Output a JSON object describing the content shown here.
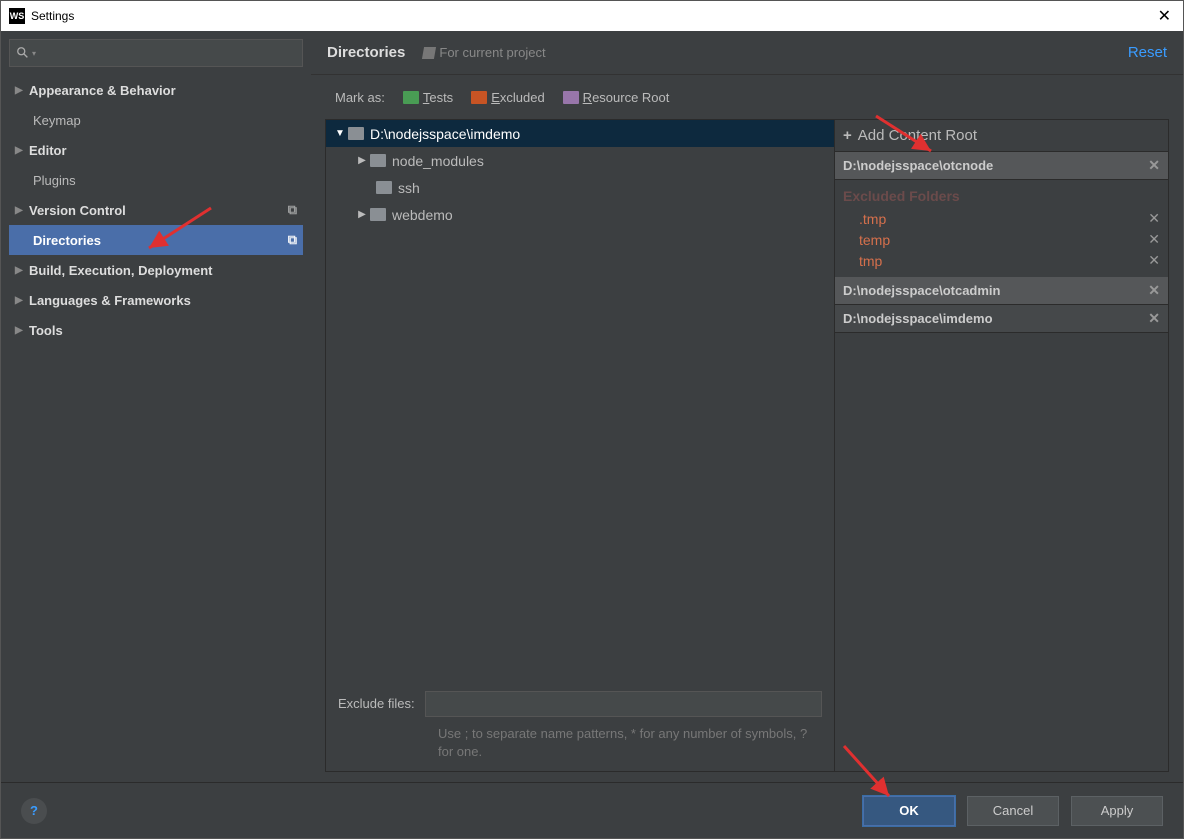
{
  "titlebar": {
    "logo": "WS",
    "title": "Settings"
  },
  "search": {
    "placeholder": ""
  },
  "sidebar": {
    "items": [
      {
        "label": "Appearance & Behavior",
        "bold": true,
        "arrow": true
      },
      {
        "label": "Keymap",
        "bold": false,
        "child": true
      },
      {
        "label": "Editor",
        "bold": true,
        "arrow": true
      },
      {
        "label": "Plugins",
        "bold": false,
        "child": true
      },
      {
        "label": "Version Control",
        "bold": true,
        "arrow": true,
        "copy": true
      },
      {
        "label": "Directories",
        "bold": true,
        "child": true,
        "selected": true,
        "copy": true
      },
      {
        "label": "Build, Execution, Deployment",
        "bold": true,
        "arrow": true
      },
      {
        "label": "Languages & Frameworks",
        "bold": true,
        "arrow": true
      },
      {
        "label": "Tools",
        "bold": true,
        "arrow": true
      }
    ]
  },
  "header": {
    "breadcrumb": "Directories",
    "project_tag": "For current project",
    "reset": "Reset"
  },
  "mark": {
    "label": "Mark as:",
    "tests": "Tests",
    "excluded": "Excluded",
    "resource": "Resource Root"
  },
  "dirtree": {
    "root": "D:\\nodejsspace\\imdemo",
    "items": [
      {
        "label": "node_modules",
        "arrow": true
      },
      {
        "label": "ssh",
        "arrow": false
      },
      {
        "label": "webdemo",
        "arrow": true
      }
    ]
  },
  "exclude": {
    "label": "Exclude files:",
    "hint": "Use ; to separate name patterns, * for any number of symbols, ? for one."
  },
  "roots": {
    "add": "Add Content Root",
    "list": [
      {
        "path": "D:\\nodejsspace\\otcnode",
        "excluded_label": "Excluded Folders",
        "excluded": [
          ".tmp",
          "temp",
          "tmp"
        ]
      },
      {
        "path": "D:\\nodejsspace\\otcadmin"
      },
      {
        "path": "D:\\nodejsspace\\imdemo"
      }
    ]
  },
  "footer": {
    "ok": "OK",
    "cancel": "Cancel",
    "apply": "Apply",
    "help": "?"
  }
}
